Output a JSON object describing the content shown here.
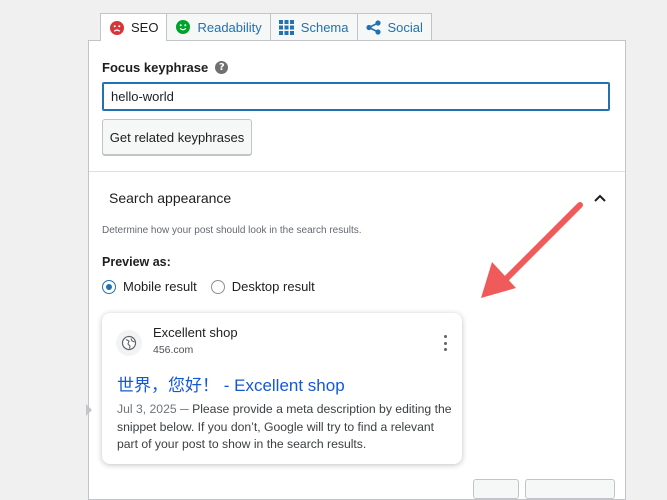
{
  "tabs": [
    {
      "label": "SEO",
      "icon": "sad-face-icon",
      "color": "#d63638"
    },
    {
      "label": "Readability",
      "icon": "smile-face-icon",
      "color": "#00a32a"
    },
    {
      "label": "Schema",
      "icon": "grid-icon",
      "color": "#2271b1"
    },
    {
      "label": "Social",
      "icon": "share-icon",
      "color": "#2271b1"
    }
  ],
  "focus": {
    "label": "Focus keyphrase",
    "help_glyph": "?",
    "value": "hello-world",
    "related_button": "Get related keyphrases"
  },
  "search_appearance": {
    "title": "Search appearance",
    "description": "Determine how your post should look in the search results.",
    "preview_label": "Preview as:",
    "options": [
      {
        "label": "Mobile result",
        "checked": true
      },
      {
        "label": "Desktop result",
        "checked": false
      }
    ]
  },
  "preview": {
    "site_name": "Excellent shop",
    "url": "456.com",
    "title": "世界，您好！ - Excellent shop",
    "date": "Jul 3, 2025",
    "separator": " ─ ",
    "snippet": "Please provide a meta description by editing the snippet below. If you don’t, Google will try to find a relevant part of your post to show in the search results."
  },
  "colors": {
    "accent": "#2271b1",
    "arrow": "#ef5a5a",
    "link": "#1558d6"
  }
}
